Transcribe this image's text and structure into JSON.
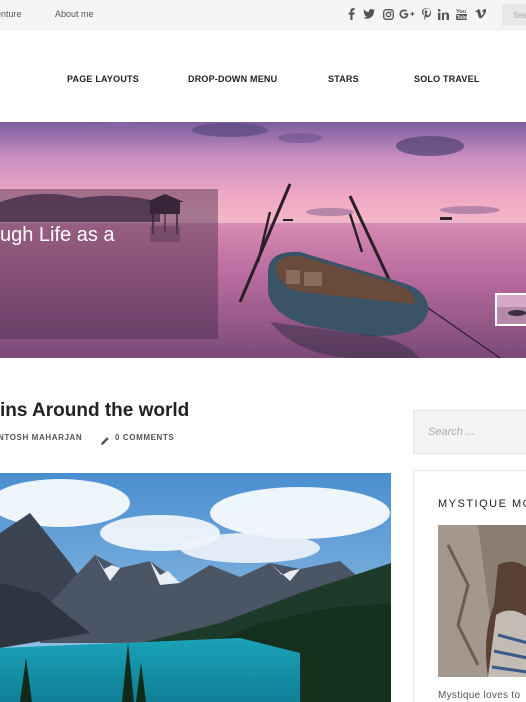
{
  "topbar": {
    "links": [
      "enture",
      "About me"
    ],
    "social_icons": [
      "facebook-icon",
      "twitter-icon",
      "instagram-icon",
      "google-plus-icon",
      "pinterest-icon",
      "linkedin-icon",
      "youtube-icon",
      "vimeo-icon"
    ],
    "search_placeholder": "Sea"
  },
  "nav": {
    "items": [
      "PAGE LAYOUTS",
      "DROP-DOWN MENU",
      "STARS",
      "SOLO TRAVEL"
    ]
  },
  "hero": {
    "title": "ugh Life as a"
  },
  "post": {
    "title": "ins Around the world",
    "author": "NTOSH MAHARJAN",
    "comments": "0 COMMENTS"
  },
  "sidebar": {
    "search_placeholder": "Search ...",
    "widget_title": "MYSTIQUE MO",
    "widget_text": "Mystique loves to"
  },
  "colors": {
    "topbar_bg": "#f5f5f5",
    "nav_text": "#222222",
    "hero_sky_top": "#6a5a9a",
    "hero_sky_mid": "#e9a0c6",
    "hero_water": "#c57aa8"
  }
}
